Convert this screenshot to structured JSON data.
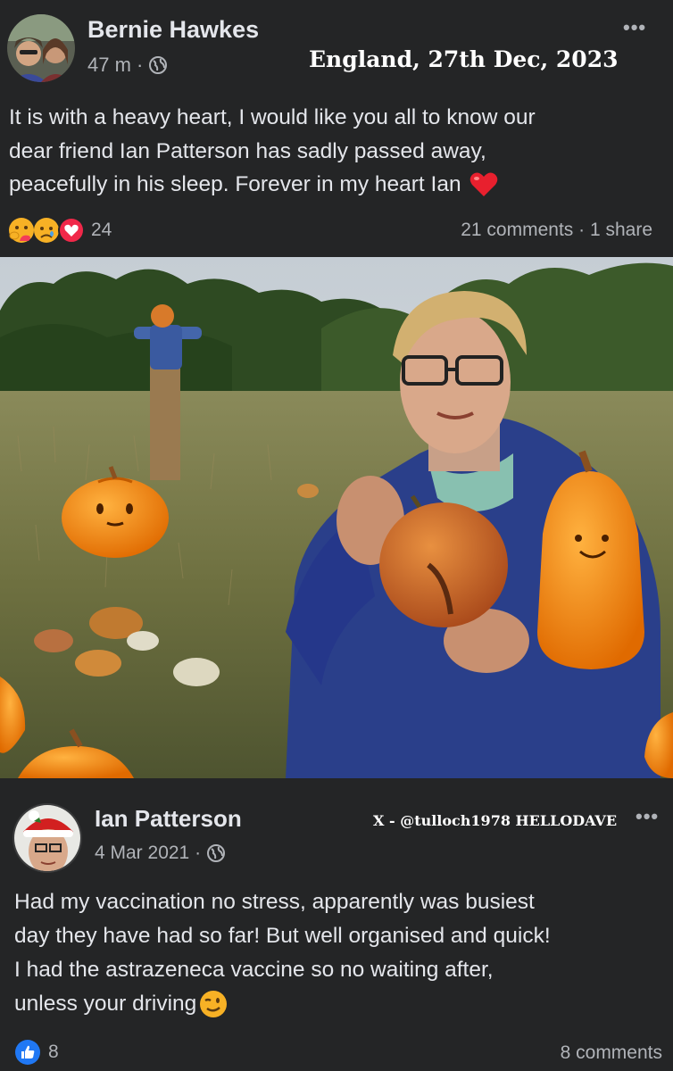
{
  "post1": {
    "author": "Bernie Hawkes",
    "time": "47 m ·",
    "overlay": "England, 27th Dec, 2023",
    "more": "•••",
    "text_lines": [
      "It is with a heavy heart, I would like you all to know our",
      "dear friend Ian Patterson has sadly passed away,",
      "peacefully in his sleep. Forever in my heart Ian"
    ],
    "reaction_count": "24",
    "comments_shares": "21 comments · 1 share"
  },
  "post2": {
    "author": "Ian Patterson",
    "time": "4 Mar 2021 ·",
    "overlay": "X - @tulloch1978 HELLODAVE",
    "more": "•••",
    "text_lines": [
      "Had my vaccination no stress, apparently was busiest",
      "day they have had so far! But well organised and quick!",
      "I had the astrazeneca vaccine so no waiting after,",
      "unless your driving"
    ],
    "like_count": "8",
    "comments": "8 comments"
  },
  "colors": {
    "background": "#242526",
    "text": "#e4e6eb",
    "secondary": "#b0b3b8",
    "like_blue": "#2078f4",
    "heart_red": "#f02849"
  }
}
